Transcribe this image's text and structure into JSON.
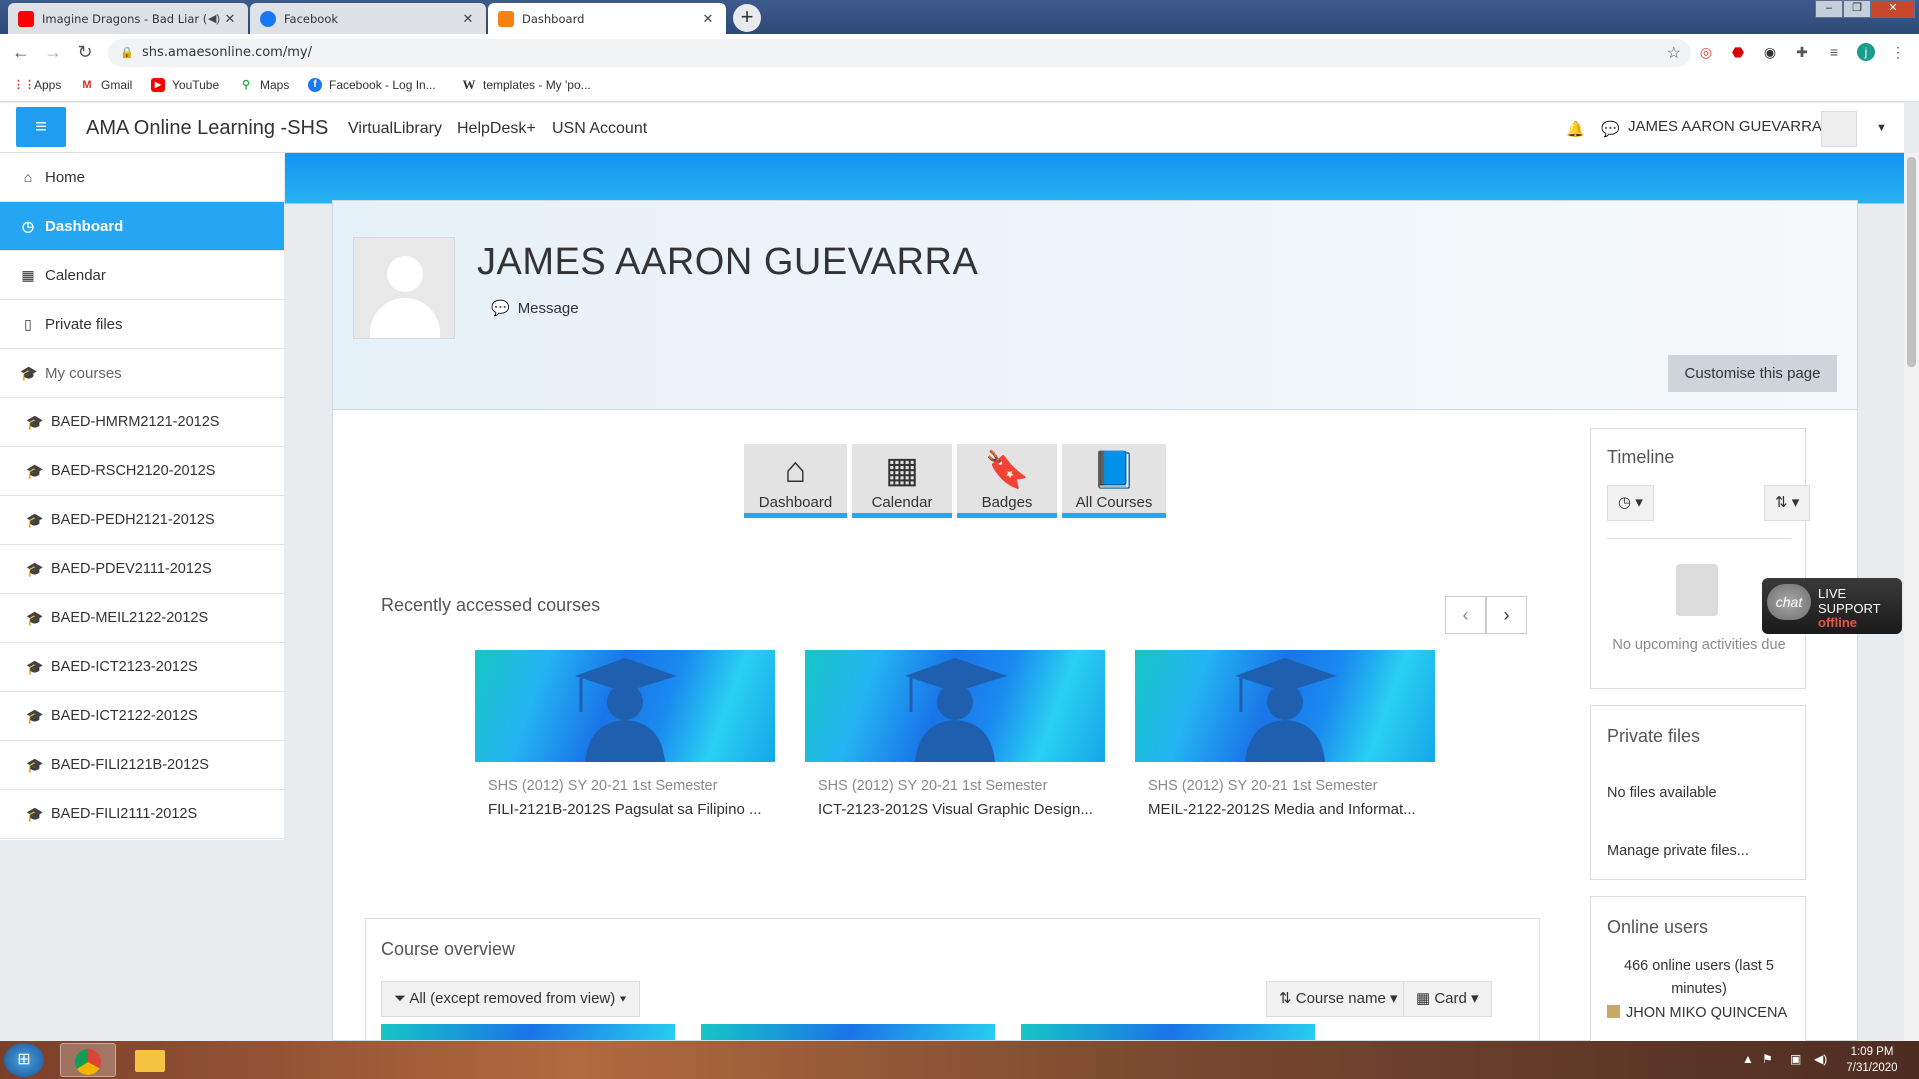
{
  "browser": {
    "tabs": [
      {
        "title": "Imagine Dragons - Bad Liar (",
        "favicon_color": "#ff0000",
        "active": false
      },
      {
        "title": "Facebook",
        "favicon_color": "#1877f2",
        "active": false
      },
      {
        "title": "Dashboard",
        "favicon_color": "#f98012",
        "active": true
      }
    ],
    "url": "shs.amaesonline.com/my/",
    "profile_initial": "j",
    "bookmarks": [
      {
        "label": "Apps",
        "icon": "apps-icon"
      },
      {
        "label": "Gmail",
        "icon": "gmail-icon"
      },
      {
        "label": "YouTube",
        "icon": "youtube-icon"
      },
      {
        "label": "Maps",
        "icon": "maps-icon"
      },
      {
        "label": "Facebook - Log In...",
        "icon": "facebook-icon"
      },
      {
        "label": "templates - My 'po...",
        "icon": "wikipedia-icon"
      }
    ]
  },
  "header": {
    "site_name": "AMA Online Learning -SHS",
    "nav": [
      "VirtualLibrary",
      "HelpDesk+",
      "USN Account"
    ],
    "user_name": "JAMES AARON GUEVARRA"
  },
  "drawer": {
    "items": [
      {
        "label": "Home",
        "icon": "home-icon"
      },
      {
        "label": "Dashboard",
        "icon": "dashboard-icon",
        "active": true
      },
      {
        "label": "Calendar",
        "icon": "calendar-icon"
      },
      {
        "label": "Private files",
        "icon": "file-icon"
      },
      {
        "label": "My courses",
        "icon": "graduation-cap-icon"
      }
    ],
    "courses": [
      "BAED-HMRM2121-2012S",
      "BAED-RSCH2120-2012S",
      "BAED-PEDH2121-2012S",
      "BAED-PDEV2111-2012S",
      "BAED-MEIL2122-2012S",
      "BAED-ICT2123-2012S",
      "BAED-ICT2122-2012S",
      "BAED-FILI2121B-2012S",
      "BAED-FILI2111-2012S"
    ]
  },
  "profile": {
    "full_name": "JAMES AARON GUEVARRA",
    "message_label": "Message",
    "customise_label": "Customise this page"
  },
  "quick_links": [
    "Dashboard",
    "Calendar",
    "Badges",
    "All Courses"
  ],
  "recent": {
    "title": "Recently accessed courses",
    "courses": [
      {
        "category": "SHS (2012) SY 20-21 1st Semester",
        "name": "FILI-2121B-2012S Pagsulat sa Filipino ..."
      },
      {
        "category": "SHS (2012) SY 20-21 1st Semester",
        "name": "ICT-2123-2012S Visual Graphic Design..."
      },
      {
        "category": "SHS (2012) SY 20-21 1st Semester",
        "name": "MEIL-2122-2012S Media and Informat..."
      }
    ]
  },
  "overview": {
    "title": "Course overview",
    "filter_label": "All (except removed from view)",
    "sort_label": "Course name",
    "view_label": "Card"
  },
  "timeline": {
    "title": "Timeline",
    "empty_text": "No upcoming activities due"
  },
  "private_files": {
    "title": "Private files",
    "empty_text": "No files available",
    "manage_label": "Manage private files..."
  },
  "online_users": {
    "title": "Online users",
    "summary_line1": "466 online users (last 5",
    "summary_line2": "minutes)",
    "first_user": "JHON MIKO QUINCENA"
  },
  "live_chat": {
    "bubble": "chat",
    "line1": "LIVE",
    "line2": "SUPPORT",
    "status": "offline"
  },
  "taskbar": {
    "time": "1:09 PM",
    "date": "7/31/2020"
  }
}
